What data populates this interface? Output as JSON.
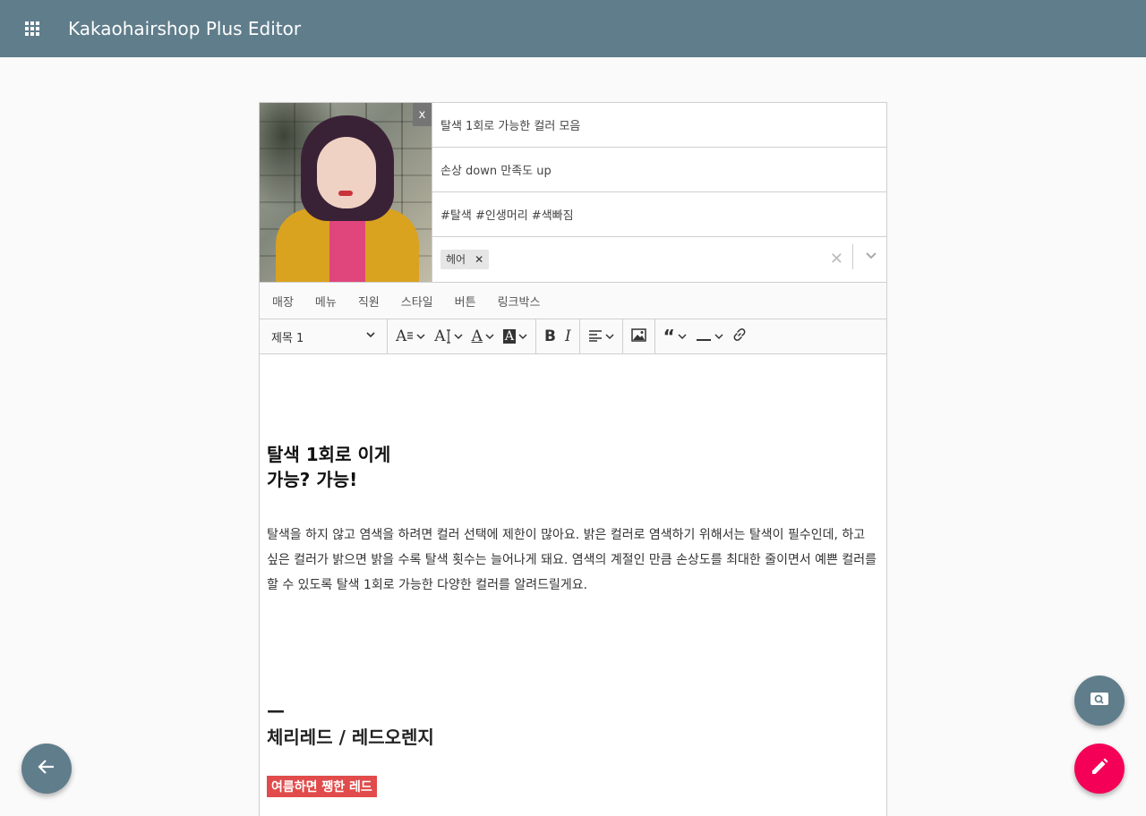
{
  "app": {
    "title": "Kakaohairshop Plus Editor"
  },
  "thumbnail": {
    "close_label": "x"
  },
  "fields": {
    "title": "탈색 1회로 가능한 컬러 모음",
    "subtitle": "손상 down 만족도 up",
    "hashtags": "#탈색 #인생머리 #색빠짐"
  },
  "tags": {
    "chips": [
      "헤어"
    ],
    "clear_label": "✕"
  },
  "tabs": [
    "매장",
    "메뉴",
    "직원",
    "스타일",
    "버튼",
    "링크박스"
  ],
  "toolbar": {
    "heading_select": "제목 1",
    "font_size": "A",
    "line_height": "A",
    "font_color": "A",
    "bg_color": "A",
    "bold": "B",
    "italic": "I"
  },
  "content": {
    "heading_line1": "탈색 1회로 이게",
    "heading_line2": "가능? 가능!",
    "paragraph": "탈색을 하지 않고 염색을 하려면 컬러 선택에 제한이 많아요. 밝은 컬러로 염색하기 위해서는 탈색이 필수인데, 하고 싶은 컬러가 밝으면 밝을 수록 탈색 횟수는 늘어나게 돼요. 염색의 계절인 만큼 손상도를 최대한 줄이면서 예쁜 컬러를 할 수 있도록 탈색 1회로 가능한 다양한 컬러를 알려드릴게요.",
    "dash": "—",
    "section_title": "체리레드 / 레드오렌지",
    "highlight_label": "여름하면 쨍한 레드"
  },
  "colors": {
    "appbar": "#607d8b",
    "fab_edit": "#f50057",
    "highlight": "#e14b4b"
  },
  "icons": {
    "apps": "apps-grid-icon",
    "back": "arrow-left-icon",
    "search": "image-search-icon",
    "edit": "pencil-icon"
  }
}
